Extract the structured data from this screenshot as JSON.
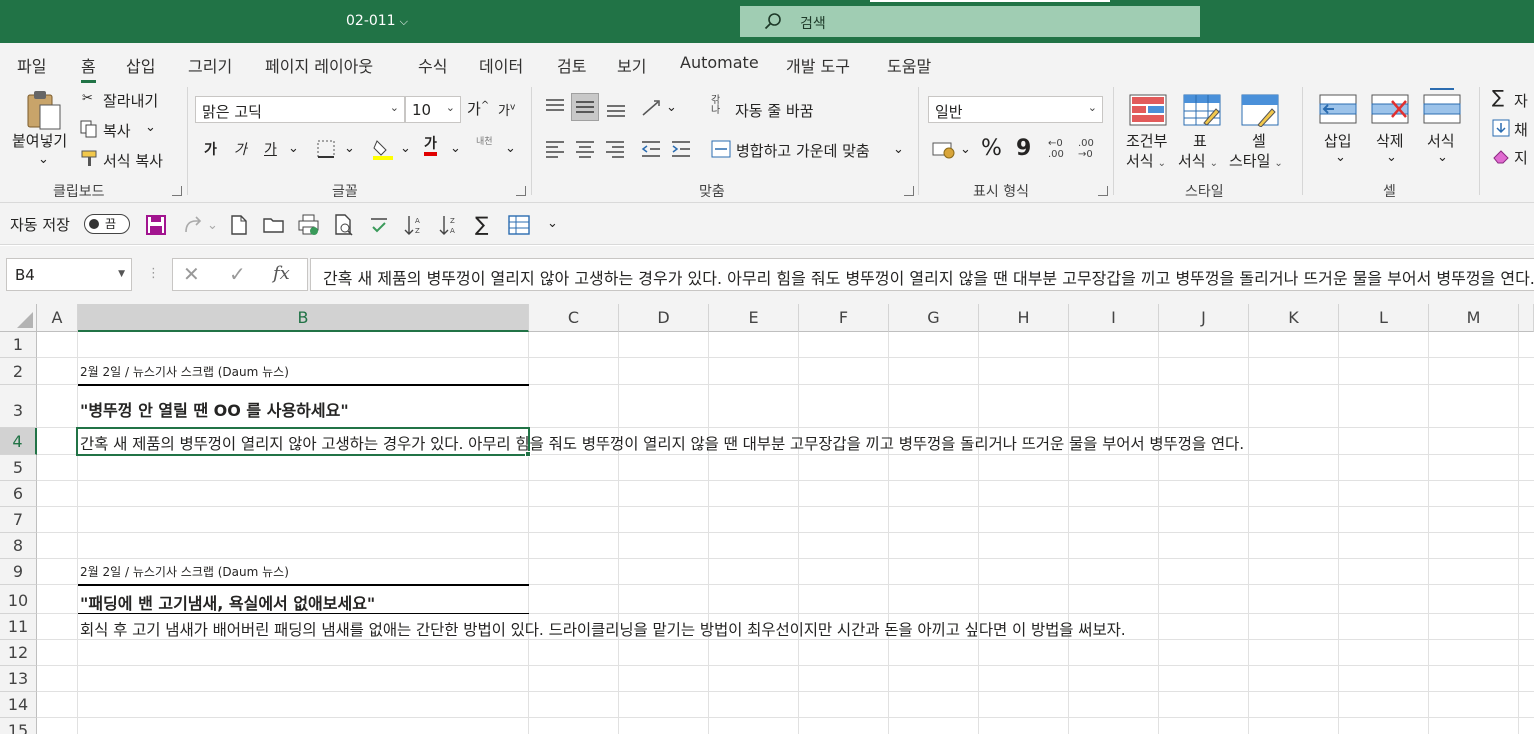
{
  "window": {
    "doc_title": "02-011",
    "search_placeholder": "검색"
  },
  "tabs": [
    "파일",
    "홈",
    "삽입",
    "그리기",
    "페이지 레이아웃",
    "수식",
    "데이터",
    "검토",
    "보기",
    "Automate",
    "개발 도구",
    "도움말"
  ],
  "active_tab": "홈",
  "ribbon": {
    "clipboard": {
      "paste": "붙여넣기",
      "cut": "잘라내기",
      "copy": "복사",
      "format_painter": "서식 복사",
      "label": "클립보드"
    },
    "font": {
      "font_name": "맑은 고딕",
      "font_size": "10",
      "grow": "가",
      "shrink": "가",
      "bold": "가",
      "italic": "가",
      "underline": "가",
      "font_color": "가",
      "phonetic": "내천",
      "label": "글꼴"
    },
    "alignment": {
      "wrap_text": "자동 줄 바꿈",
      "wrap_icon_text": "갂나",
      "merge_center": "병합하고 가운데 맞춤",
      "label": "맞춤"
    },
    "number": {
      "format": "일반",
      "percent": "%",
      "comma": "9",
      "inc_decimal": "←0 .00",
      "dec_decimal": ".00 →0",
      "label": "표시 형식"
    },
    "styles": {
      "conditional_1": "조건부",
      "conditional_2": "서식",
      "table_1": "표",
      "table_2": "서식",
      "cell_styles_1": "셀",
      "cell_styles_2": "스타일",
      "label": "스타일"
    },
    "cells": {
      "insert": "삽입",
      "delete": "삭제",
      "format": "서식",
      "label": "셀"
    },
    "editing": {
      "autosum": "자",
      "fill": "채",
      "clear": "지"
    }
  },
  "qat": {
    "autosave_label": "자동 저장",
    "autosave_state": "끔"
  },
  "formula_bar": {
    "name_box": "B4",
    "formula": "간혹 새 제품의 병뚜껑이 열리지 않아 고생하는 경우가 있다. 아무리 힘을 줘도 병뚜껑이 열리지 않을 땐 대부분 고무장갑을 끼고 병뚜껑을 돌리거나 뜨거운 물을 부어서 병뚜껑을 연다."
  },
  "sheet": {
    "columns": [
      "A",
      "B",
      "C",
      "D",
      "E",
      "F",
      "G",
      "H",
      "I",
      "J",
      "K",
      "L",
      "M"
    ],
    "selected_column": "B",
    "rows": [
      "1",
      "2",
      "3",
      "4",
      "5",
      "6",
      "7",
      "8",
      "9",
      "10",
      "11",
      "12",
      "13",
      "14",
      "15"
    ],
    "selected_row": "4",
    "cells": {
      "B2": "2월 2일 / 뉴스기사 스크랩 (Daum 뉴스)",
      "B3": "\"병뚜껑 안 열릴 땐 OO 를 사용하세요\"",
      "B4": "간혹 새 제품의 병뚜껑이 열리지 않아 고생하는 경우가 있다. 아무리 힘을 줘도 병뚜껑이 열리지 않을 땐 대부분 고무장갑을 끼고 병뚜껑을 돌리거나 뜨거운 물을 부어서 병뚜껑을 연다.",
      "B9": "2월 2일 / 뉴스기사 스크랩 (Daum 뉴스)",
      "B10": "\"패딩에 밴 고기냄새, 욕실에서 없애보세요\"",
      "B11": "회식 후 고기 냄새가 배어버린 패딩의 냄새를 없애는 간단한 방법이 있다. 드라이클리닝을 맡기는 방법이 최우선이지만 시간과 돈을 아끼고 싶다면 이 방법을 써보자."
    }
  },
  "colors": {
    "accent": "#217346",
    "ribbon_bg": "#f3f3f3",
    "search_bg": "#a0cdb3"
  }
}
